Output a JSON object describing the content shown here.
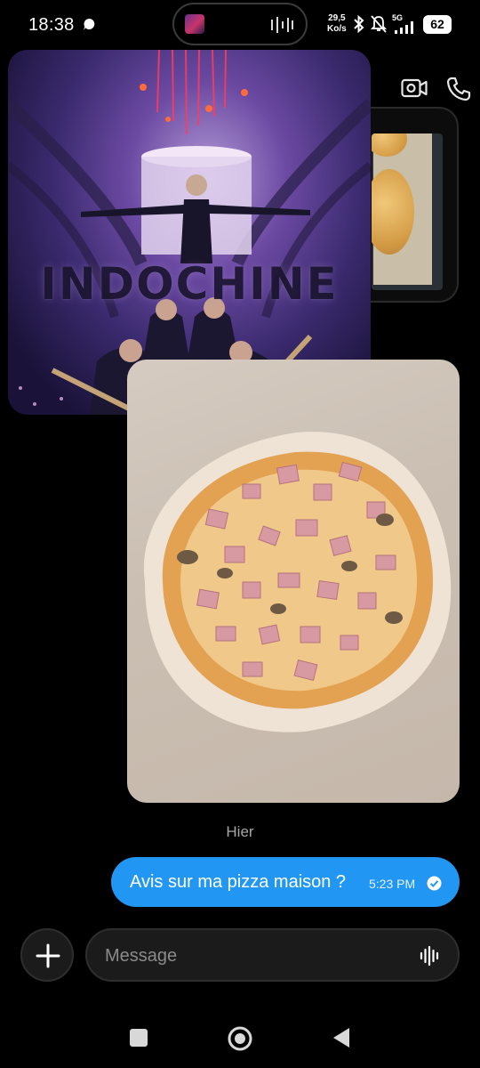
{
  "status_bar": {
    "time": "18:38",
    "net_speed_value": "29,5",
    "net_speed_unit": "Ko/s",
    "network": "5G",
    "battery": "62"
  },
  "header": {
    "icons": [
      "video-call-icon",
      "phone-call-icon"
    ]
  },
  "messages": {
    "day_separator": "Hier",
    "outgoing_text": "Avis sur ma pizza maison ?",
    "outgoing_time": "5:23 PM",
    "poster_title": "INDOCHINE"
  },
  "composer": {
    "placeholder": "Message"
  },
  "colors": {
    "bubble": "#2196f3",
    "background": "#000000",
    "input_bg": "#1b1b1b"
  },
  "nav_bar": {
    "icons": [
      "recents-square-icon",
      "home-circle-icon",
      "back-triangle-icon"
    ]
  }
}
